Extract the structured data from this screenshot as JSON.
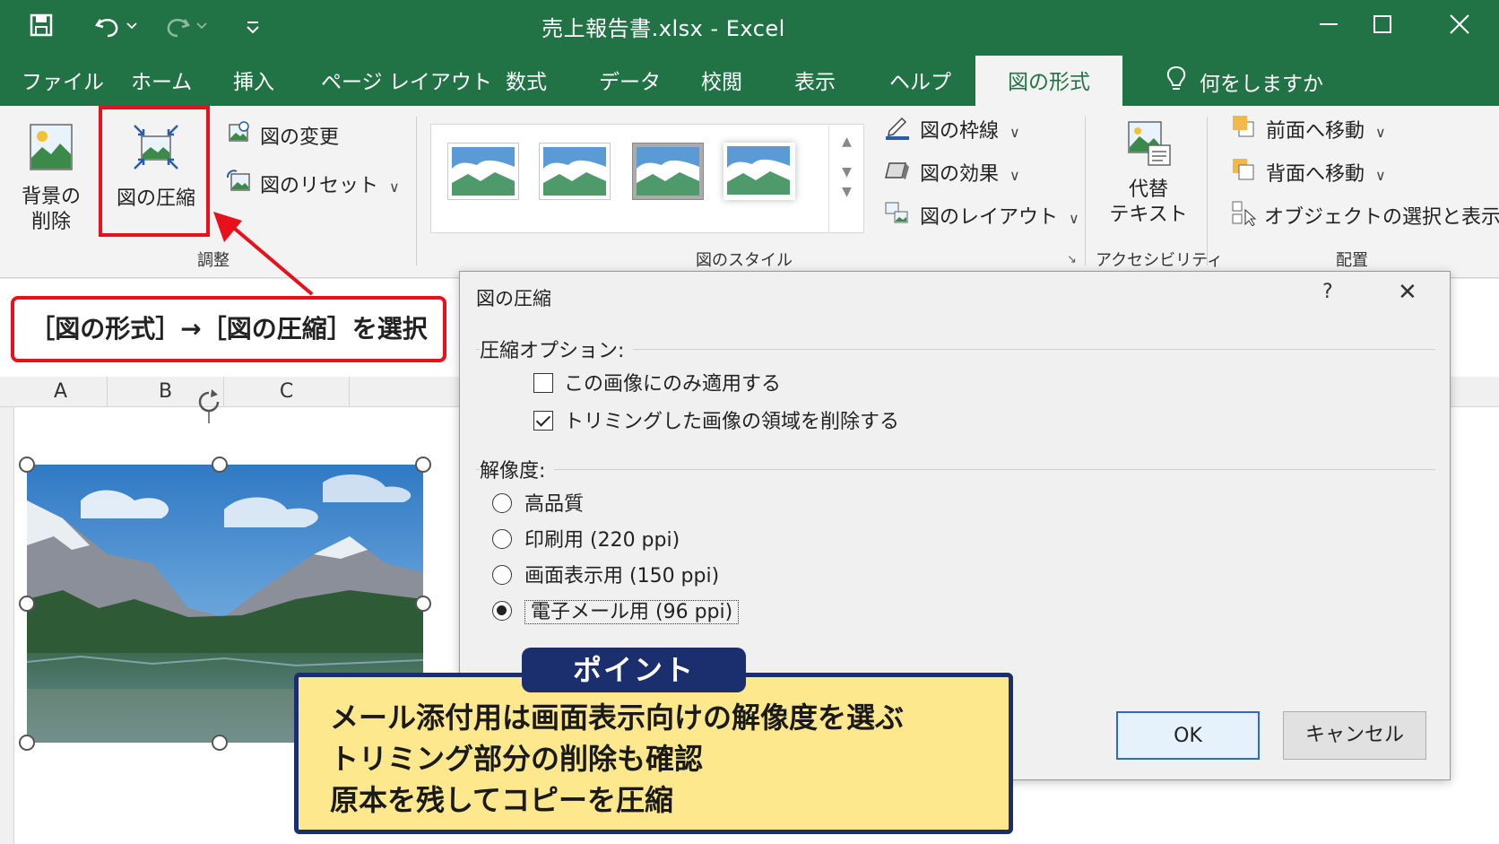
{
  "window": {
    "title": "売上報告書.xlsx  -  Excel"
  },
  "menu": {
    "tabs": [
      "ファイル",
      "ホーム",
      "挿入",
      "ページ レイアウト",
      "数式",
      "データ",
      "校閲",
      "表示",
      "ヘルプ",
      "図の形式"
    ],
    "active_tab": "図の形式",
    "tell_me": "何をしますか"
  },
  "ribbon": {
    "adjust": {
      "remove_bg": [
        "背景の",
        "削除"
      ],
      "compress": "図の圧縮",
      "change": "図の変更",
      "reset": "図のリセット",
      "group_label": "調整"
    },
    "styles": {
      "group_label": "図のスタイル",
      "border": "図の枠線",
      "effects": "図の効果",
      "layout": "図のレイアウト"
    },
    "accessibility": {
      "alt_text": [
        "代替",
        "テキスト"
      ],
      "group_label": "アクセシビリティ"
    },
    "arrange": {
      "bring_forward": "前面へ移動",
      "send_backward": "背面へ移動",
      "selection_pane": "オブジェクトの選択と表示",
      "group_label": "配置"
    }
  },
  "sheet": {
    "columns": [
      "A",
      "B",
      "C"
    ]
  },
  "callout_select": "［図の形式］→［図の圧縮］を選択",
  "dialog": {
    "title": "図の圧縮",
    "help": "?",
    "close": "✕",
    "compress_options_label": "圧縮オプション:",
    "options": [
      {
        "label": "この画像にのみ適用する",
        "checked": false
      },
      {
        "label": "トリミングした画像の領域を削除する",
        "checked": true
      }
    ],
    "resolution_label": "解像度:",
    "resolutions": [
      {
        "label": "高品質",
        "selected": false
      },
      {
        "label": "印刷用 (220 ppi)",
        "selected": false
      },
      {
        "label": "画面表示用 (150 ppi)",
        "selected": false
      },
      {
        "label": "電子メール用 (96 ppi)",
        "selected": true
      }
    ],
    "ok": "OK",
    "cancel": "キャンセル"
  },
  "point": {
    "heading": "ポイント",
    "lines": [
      "メール添付用は画面表示向けの解像度を選ぶ",
      "トリミング部分の削除も確認",
      "原本を残してコピーを圧縮"
    ]
  },
  "colors": {
    "excel_green": "#217346",
    "highlight_red": "#e8101a",
    "point_navy": "#1b2f6e",
    "point_yellow": "#fde88d"
  }
}
